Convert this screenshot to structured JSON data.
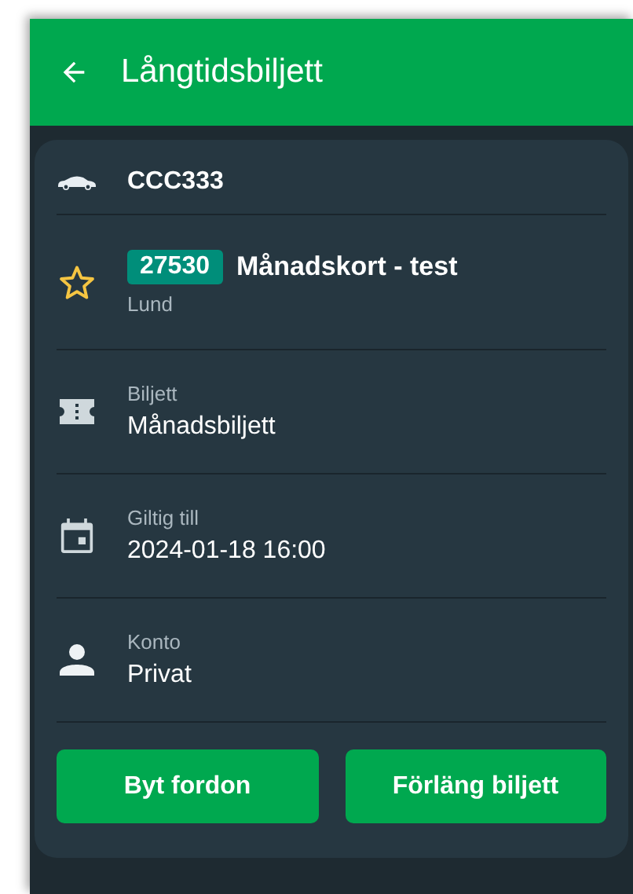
{
  "header": {
    "title": "Långtidsbiljett"
  },
  "vehicle": {
    "plate": "CCC333"
  },
  "zone": {
    "code": "27530",
    "name": "Månadskort - test",
    "city": "Lund"
  },
  "details": [
    {
      "kind": "ticket",
      "label": "Biljett",
      "value": "Månadsbiljett"
    },
    {
      "kind": "calendar",
      "label": "Giltig till",
      "value": "2024-01-18 16:00"
    },
    {
      "kind": "person",
      "label": "Konto",
      "value": "Privat"
    }
  ],
  "buttons": [
    "Byt fordon",
    "Förläng biljett"
  ]
}
